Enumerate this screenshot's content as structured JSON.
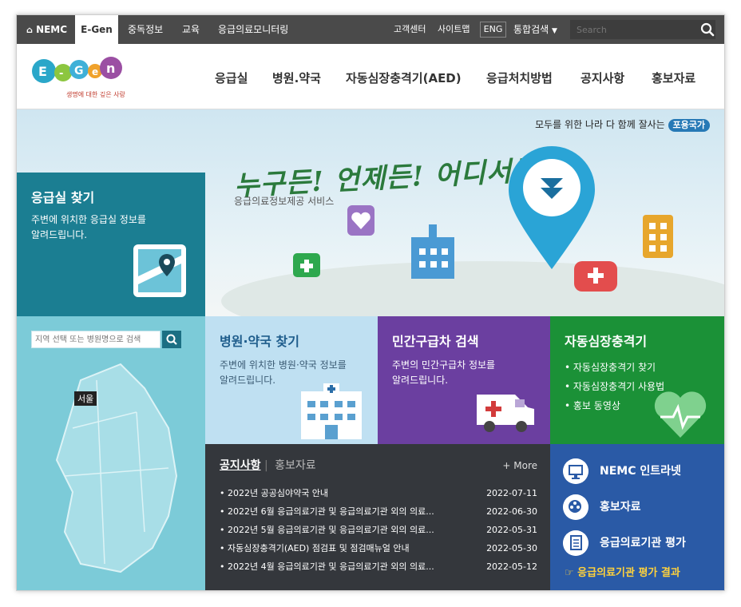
{
  "topbar": {
    "tabs": [
      "NEMC",
      "E-Gen",
      "중독정보",
      "교육",
      "응급의료모니터링"
    ],
    "utility": [
      "고객센터",
      "사이트맵"
    ],
    "eng": "ENG",
    "search_select": "통합검색",
    "search_placeholder": "Search"
  },
  "logo": {
    "text": "E-Gen",
    "tagline": "생명에 대한 깊은 사랑"
  },
  "nav": [
    "응급실",
    "병원.약국",
    "자동심장충격기(AED)",
    "응급처치방법",
    "공지사항",
    "홍보자료"
  ],
  "hero": {
    "slogan": "모두를 위한 나라 다 함께 잘사는",
    "slogan_pill": "포용국가",
    "title": "누구든! 언제든! 어디서든!",
    "subtitle": "응급의료정보제공 서비스"
  },
  "er": {
    "title": "응급실 찾기",
    "desc1": "주변에 위치한 응급실 정보를",
    "desc2": "알려드립니다."
  },
  "map": {
    "search_placeholder": "지역 선택 또는 병원명으로 검색",
    "marker": "서울"
  },
  "tiles": {
    "hospital": {
      "title": "병원·약국 찾기",
      "desc1": "주변에 위치한 병원·약국 정보를",
      "desc2": "알려드립니다."
    },
    "ambulance": {
      "title": "민간구급차 검색",
      "desc1": "주변의 민간구급차 정보를",
      "desc2": "알려드립니다."
    },
    "aed": {
      "title": "자동심장충격기",
      "items": [
        "• 자동심장충격기 찾기",
        "• 자동심장충격기 사용법",
        "• 홍보 동영상"
      ]
    }
  },
  "notice": {
    "tab_active": "공지사항",
    "tab_other": "홍보자료",
    "more": "+ More",
    "items": [
      {
        "title": "• 2022년 공공심야약국 안내",
        "date": "2022-07-11"
      },
      {
        "title": "• 2022년 6월 응급의료기관 및 응급의료기관 외의 의료...",
        "date": "2022-06-30"
      },
      {
        "title": "• 2022년 5월 응급의료기관 및 응급의료기관 외의 의료...",
        "date": "2022-05-31"
      },
      {
        "title": "• 자동심장충격기(AED) 점검표 및 점검매뉴얼 안내",
        "date": "2022-05-30"
      },
      {
        "title": "• 2022년 4월 응급의료기관 및 응급의료기관 외의 의료...",
        "date": "2022-05-12"
      }
    ]
  },
  "links": {
    "items": [
      "NEMC 인트라넷",
      "홍보자료",
      "응급의료기관 평가"
    ],
    "result": "☞ 응급의료기관 평가 결과"
  },
  "colors": {
    "topbar": "#4a4a4a",
    "er": "#1b7e92",
    "ambulance": "#6b3fa0",
    "aed": "#1b9137",
    "links": "#2a5aa6",
    "notice": "#34373c"
  }
}
